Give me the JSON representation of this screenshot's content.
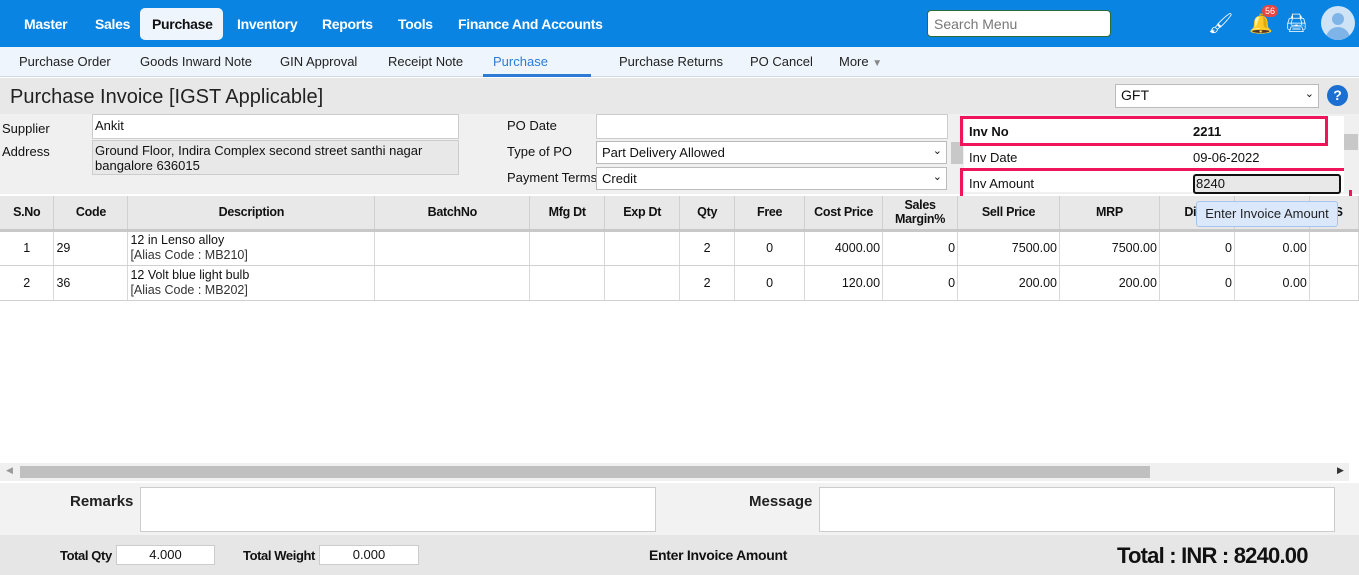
{
  "topnav": {
    "items": [
      "Master",
      "Sales",
      "Purchase",
      "Inventory",
      "Reports",
      "Tools",
      "Finance And Accounts"
    ],
    "active": "Purchase",
    "search_placeholder": "Search Menu",
    "notification_count": "56",
    "accent": "#0a84e3"
  },
  "subnav": {
    "items": [
      "Purchase Order",
      "Goods Inward Note",
      "GIN Approval",
      "Receipt Note",
      "Purchase Invoice",
      "Purchase Returns",
      "PO Cancel",
      "More"
    ],
    "active": "Purchase Invoice"
  },
  "page": {
    "title": "Purchase Invoice [IGST Applicable]",
    "branch_select": "GFT",
    "help": "?"
  },
  "form": {
    "supplier_label": "Supplier",
    "supplier": "Ankit",
    "address_label": "Address",
    "address": "Ground Floor, Indira Complex second street santhi nagar bangalore 636015",
    "po_date_label": "PO Date",
    "po_date": "",
    "type_of_po_label": "Type of PO",
    "type_of_po": "Part Delivery Allowed",
    "payment_terms_label": "Payment Terms",
    "payment_terms": "Credit",
    "inv_no_label": "Inv No",
    "inv_no": "2211",
    "inv_date_label": "Inv Date",
    "inv_date": "09-06-2022",
    "inv_amount_label": "Inv Amount",
    "inv_amount": "8240",
    "tooltip": "Enter Invoice Amount"
  },
  "grid": {
    "columns": [
      "S.No",
      "Code",
      "Description",
      "BatchNo",
      "Mfg Dt",
      "Exp Dt",
      "Qty",
      "Free",
      "Cost Price",
      "Sales Margin%",
      "Sell Price",
      "MRP",
      "Disc",
      "",
      "GS"
    ],
    "rows": [
      {
        "sno": "1",
        "code": "29",
        "desc": "12 in Lenso alloy",
        "alias": "[Alias Code : MB210]",
        "batch": "",
        "mfg": "",
        "exp": "",
        "qty": "2",
        "free": "0",
        "cost": "4000.00",
        "margin": "0",
        "sell": "7500.00",
        "mrp": "7500.00",
        "disc": "0",
        "c14": "0.00"
      },
      {
        "sno": "2",
        "code": "36",
        "desc": "12 Volt blue light bulb",
        "alias": "[Alias Code : MB202]",
        "batch": "",
        "mfg": "",
        "exp": "",
        "qty": "2",
        "free": "0",
        "cost": "120.00",
        "margin": "0",
        "sell": "200.00",
        "mrp": "200.00",
        "disc": "0",
        "c14": "0.00"
      }
    ]
  },
  "bottom": {
    "remarks_label": "Remarks",
    "message_label": "Message",
    "total_qty_label": "Total Qty",
    "total_qty": "4.000",
    "total_weight_label": "Total Weight",
    "total_weight": "0.000",
    "status": "Enter Invoice Amount",
    "total": "Total : INR : 8240.00"
  }
}
